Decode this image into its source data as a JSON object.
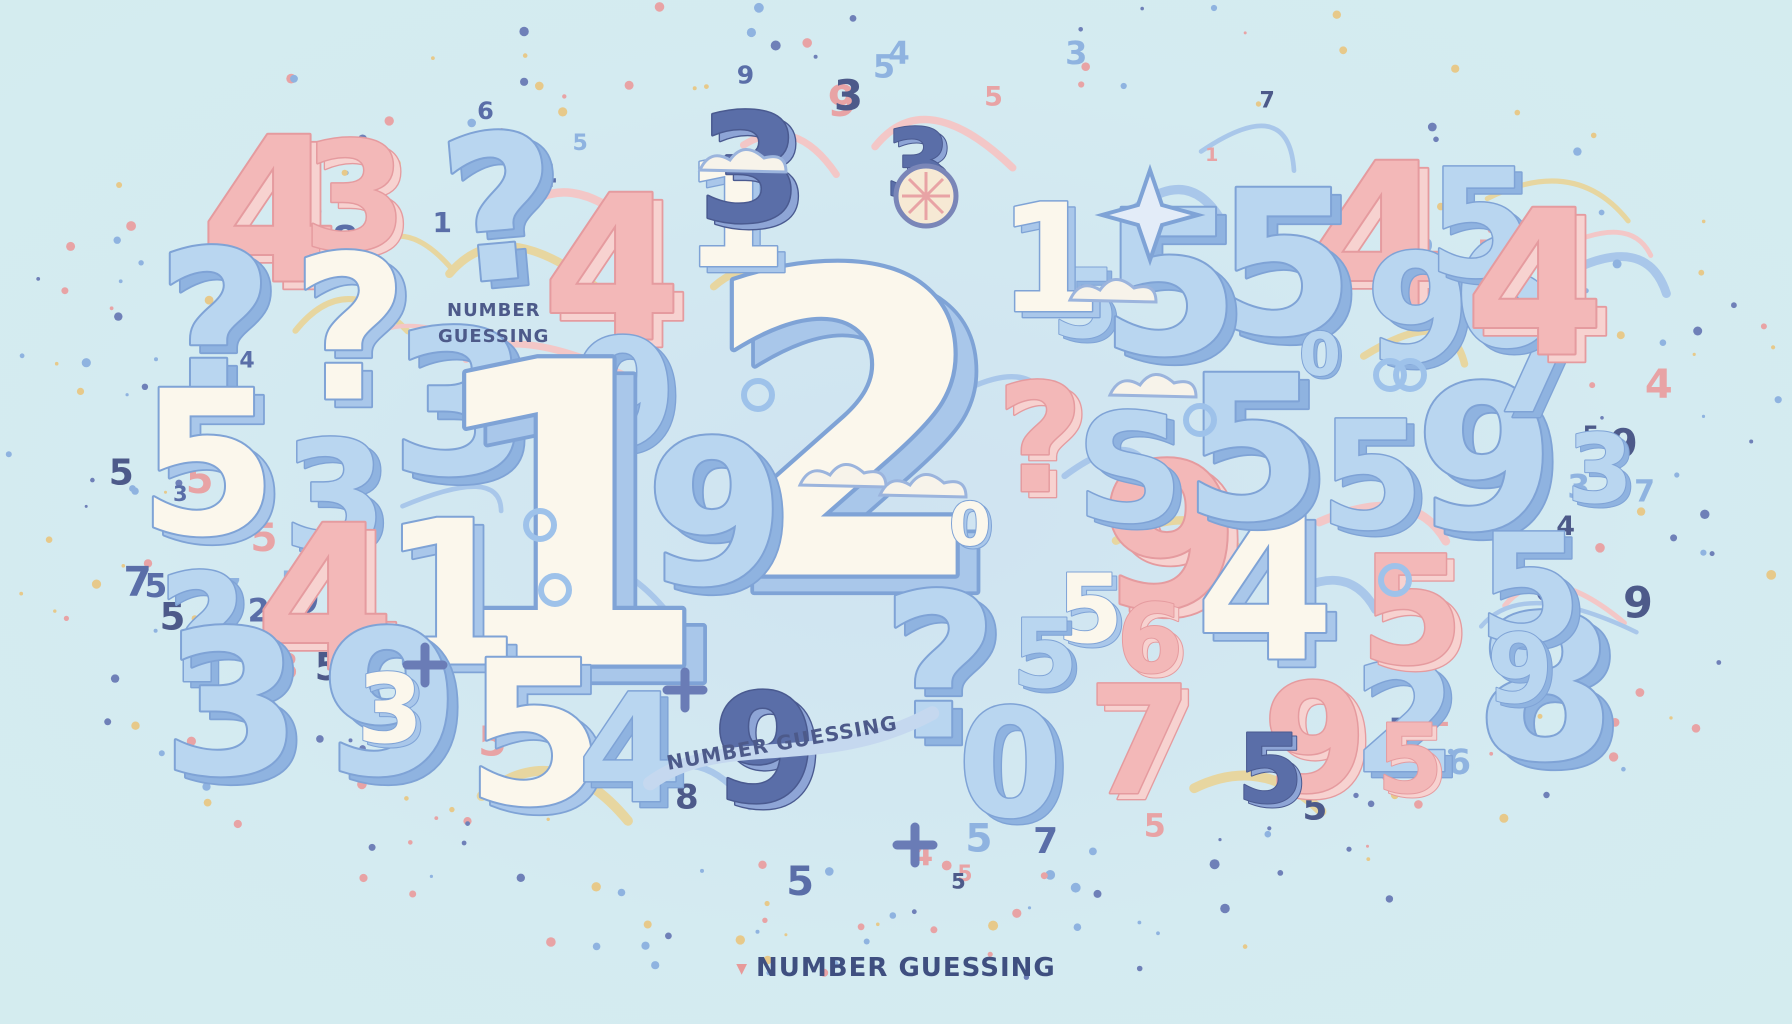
{
  "labels": {
    "caption_main": "NUMBER GUESSING",
    "caption_left_line1": "NUMBER",
    "caption_left_line2": "GUESSING",
    "caption_banner": "NUMBER GUESSING"
  },
  "colors": {
    "background": "#d4ecef",
    "pale_blue": "#b9d6f0",
    "cream": "#fbf7ec",
    "pink": "#f3b8b8",
    "navy": "#5a6ea8",
    "outline": "#7fa3d6"
  },
  "digits": [
    {
      "char": "2",
      "style": "cream",
      "size": "xxl"
    },
    {
      "char": "4",
      "style": "pink",
      "size": "xl"
    },
    {
      "char": "3",
      "style": "pink",
      "size": "l"
    },
    {
      "char": "?",
      "style": "blue",
      "size": "xl"
    },
    {
      "char": "4",
      "style": "pink",
      "size": "xl"
    },
    {
      "char": "1",
      "style": "cream",
      "size": "l"
    },
    {
      "char": "3",
      "style": "navy",
      "size": "m"
    },
    {
      "char": "4",
      "style": "pink",
      "size": "xl"
    },
    {
      "char": "5",
      "style": "blue",
      "size": "xl"
    },
    {
      "char": "9",
      "style": "blue",
      "size": "l"
    },
    {
      "char": "?",
      "style": "blue",
      "size": "xl"
    },
    {
      "char": "?",
      "style": "cream",
      "size": "xl"
    },
    {
      "char": "3",
      "style": "blue",
      "size": "xl"
    },
    {
      "char": "9",
      "style": "blue",
      "size": "l"
    },
    {
      "char": "5",
      "style": "cream",
      "size": "xl"
    },
    {
      "char": "3",
      "style": "blue",
      "size": "l"
    },
    {
      "char": "1",
      "style": "cream",
      "size": "xxl"
    },
    {
      "char": "9",
      "style": "blue",
      "size": "xl"
    },
    {
      "char": "?",
      "style": "blue",
      "size": "l"
    },
    {
      "char": "4",
      "style": "pink",
      "size": "xl"
    },
    {
      "char": "1",
      "style": "cream",
      "size": "xl"
    },
    {
      "char": "3",
      "style": "blue",
      "size": "xl"
    },
    {
      "char": "9",
      "style": "blue",
      "size": "xl"
    },
    {
      "char": "5",
      "style": "cream",
      "size": "xl"
    },
    {
      "char": "4",
      "style": "blue",
      "size": "l"
    },
    {
      "char": "9",
      "style": "navy",
      "size": "l"
    },
    {
      "char": "0",
      "style": "blue",
      "size": "l"
    },
    {
      "char": "7",
      "style": "pink",
      "size": "l"
    },
    {
      "char": "9",
      "style": "pink",
      "size": "l"
    },
    {
      "char": "2",
      "style": "blue",
      "size": "l"
    },
    {
      "char": "8",
      "style": "blue",
      "size": "xl"
    },
    {
      "char": "?",
      "style": "blue",
      "size": "xl"
    },
    {
      "char": "9",
      "style": "pink",
      "size": "xl"
    },
    {
      "char": "4",
      "style": "cream",
      "size": "xl"
    },
    {
      "char": "5",
      "style": "pink",
      "size": "l"
    },
    {
      "char": "5",
      "style": "blue",
      "size": "xl"
    },
    {
      "char": "5",
      "style": "blue",
      "size": "l"
    },
    {
      "char": "9",
      "style": "blue",
      "size": "xl"
    },
    {
      "char": "?",
      "style": "pink",
      "size": "l"
    },
    {
      "char": "S",
      "style": "blue",
      "size": "l"
    },
    {
      "char": "7",
      "style": "blue",
      "size": "l"
    },
    {
      "char": "6",
      "style": "blue",
      "size": "l"
    },
    {
      "char": "5",
      "style": "blue",
      "size": "l"
    },
    {
      "char": "5",
      "style": "blue",
      "size": "l"
    },
    {
      "char": "3",
      "style": "navy",
      "size": "l"
    },
    {
      "char": "5",
      "style": "blue",
      "size": "m"
    },
    {
      "char": "1",
      "style": "cream",
      "size": "l"
    },
    {
      "char": "5",
      "style": "blue",
      "size": "xl"
    },
    {
      "char": "4",
      "style": "pink",
      "size": "xl"
    },
    {
      "char": "9",
      "style": "blue",
      "size": "m"
    },
    {
      "char": "0",
      "style": "blue",
      "size": "s"
    },
    {
      "char": "5",
      "style": "cream",
      "size": "m"
    },
    {
      "char": "5",
      "style": "blue",
      "size": "m"
    },
    {
      "char": "3",
      "style": "cream",
      "size": "m"
    },
    {
      "char": "5",
      "style": "navy",
      "size": "m"
    },
    {
      "char": "6",
      "style": "pink",
      "size": "m"
    },
    {
      "char": "0",
      "style": "cream",
      "size": "s"
    },
    {
      "char": "5",
      "style": "pink",
      "size": "m"
    },
    {
      "char": "3",
      "style": "blue",
      "size": "m"
    }
  ],
  "small_digits": [
    "3",
    "4",
    "5",
    "5",
    "4",
    "5",
    "5",
    "9",
    "5",
    "5",
    "5",
    "5",
    "4",
    "5",
    "2",
    "3",
    "8",
    "7",
    "5",
    "4",
    "3",
    "5",
    "7",
    "5",
    "5",
    "4",
    "5",
    "4",
    "7",
    "9",
    "3",
    "5",
    "5",
    "5",
    "9",
    "5",
    "6",
    "1",
    "6",
    "7",
    "7",
    "3",
    "5",
    "0",
    "1",
    "2",
    "7",
    "3",
    "9",
    "5",
    "5",
    "8",
    "2",
    "5",
    "6",
    "5",
    "7",
    "3",
    "3",
    "9",
    "0",
    "5",
    "4",
    "5",
    "6"
  ],
  "decorations": {
    "sun_icon": "sun-icon",
    "star_icon": "sparkle-star-icon",
    "cloud_icon": "cloud-icon",
    "plus_icon": "plus-icon",
    "ring_icon": "ring-icon"
  }
}
